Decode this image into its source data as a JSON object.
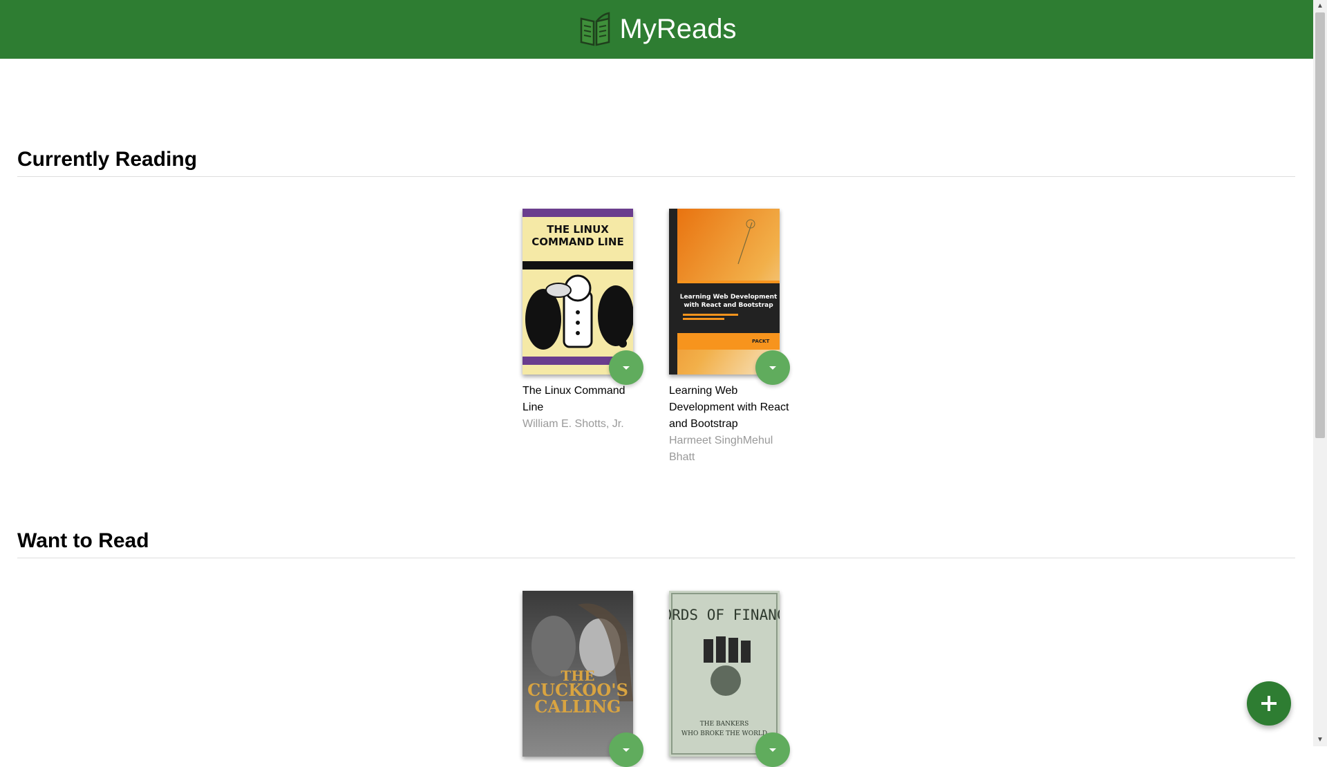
{
  "header": {
    "title": "MyReads",
    "logo_icon": "open-book-icon"
  },
  "colors": {
    "header_bg": "#2e7d32",
    "changer_bg": "#60ac5d",
    "fab_bg": "#2e7d32",
    "author_text": "#999999"
  },
  "shelves": [
    {
      "title": "Currently Reading",
      "books": [
        {
          "title": "The Linux Command Line",
          "authors": "William E. Shotts, Jr.",
          "cover_text": {
            "line1": "THE LINUX",
            "line2": "COMMAND LINE"
          }
        },
        {
          "title": "Learning Web Development with React and Bootstrap",
          "authors": "Harmeet SinghMehul Bhatt",
          "cover_text": {
            "line1": "Learning Web Development",
            "line2": "with React and Bootstrap",
            "publisher": "PACKT"
          }
        }
      ]
    },
    {
      "title": "Want to Read",
      "books": [
        {
          "title": "",
          "authors": "",
          "cover_text": {
            "line1": "THE",
            "line2": "CUCKOO'S",
            "line3": "CALLING"
          }
        },
        {
          "title": "",
          "authors": "",
          "cover_text": {
            "line1": "LORDS OF FINANCE",
            "line2": "THE BANKERS",
            "line3": "WHO BROKE THE WORLD"
          }
        }
      ]
    }
  ],
  "fab": {
    "label": "+",
    "icon": "plus-icon"
  },
  "scrollbar": {
    "up_icon": "▲",
    "down_icon": "▼"
  }
}
